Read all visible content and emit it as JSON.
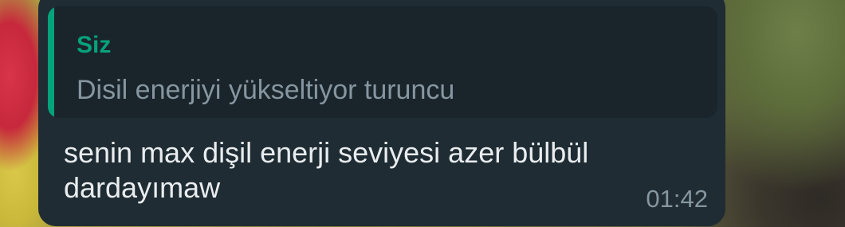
{
  "quoted_message": {
    "author": "Siz",
    "text": "Disil enerjiyi yükseltiyor turuncu"
  },
  "message": {
    "text": "senin max dişil enerji seviyesi azer bülbül dardayımaw",
    "time": "01:42"
  },
  "colors": {
    "bubble": "#1f2c33",
    "quote_bg": "#1a252b",
    "accent": "#06a27b",
    "text_primary": "#e9edef",
    "text_secondary": "#8696a0"
  }
}
